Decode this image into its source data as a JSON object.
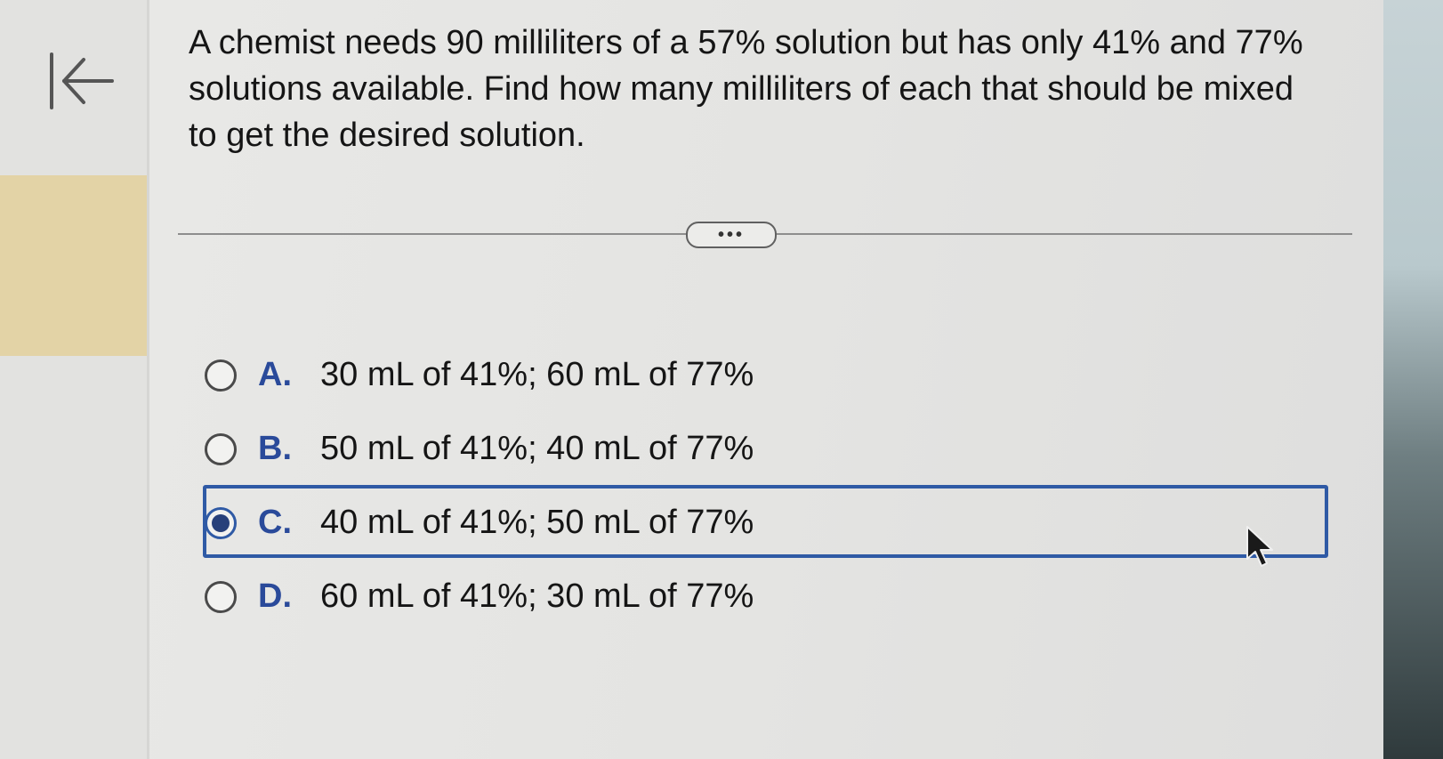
{
  "question": {
    "text": "A chemist needs 90 milliliters of a 57% solution but has only 41% and 77% solutions available. Find how many milliliters of each that should be mixed to get the desired solution."
  },
  "more_button": {
    "label": "•••"
  },
  "options": [
    {
      "letter": "A.",
      "text": "30 mL of 41%; 60 mL of 77%",
      "selected": false
    },
    {
      "letter": "B.",
      "text": "50 mL of 41%; 40 mL of 77%",
      "selected": false
    },
    {
      "letter": "C.",
      "text": "40 mL of 41%; 50 mL of 77%",
      "selected": true
    },
    {
      "letter": "D.",
      "text": "60 mL of 41%; 30 mL of 77%",
      "selected": false
    }
  ],
  "colors": {
    "accent": "#2f5aa5",
    "letter": "#2a4a9a",
    "rail_highlight": "#e3d3a6"
  },
  "icons": {
    "back": "back-to-start-icon",
    "cursor": "mouse-pointer-icon"
  }
}
